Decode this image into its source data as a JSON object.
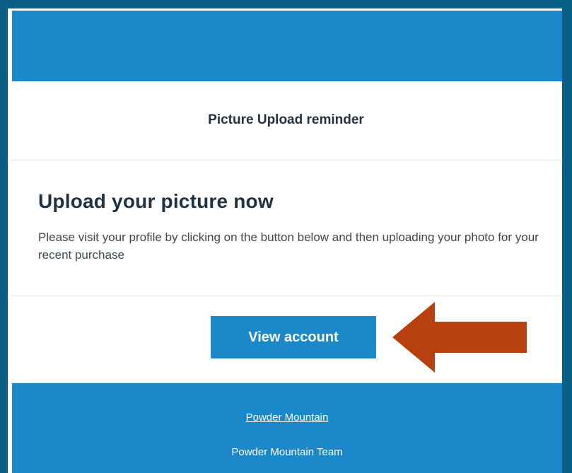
{
  "email": {
    "subject": "Picture Upload reminder",
    "heading": "Upload your picture now",
    "body": "Please visit your profile by clicking on the button below and then uploading your photo for your recent purchase",
    "cta_label": "View account",
    "footer": {
      "link": "Powder Mountain",
      "signature": "Powder Mountain Team"
    }
  },
  "colors": {
    "background": "#0a5f87",
    "brand_blue": "#1a88c9",
    "heading_text": "#1f3242",
    "arrow": "#b8400f"
  },
  "icons": {
    "annotation_arrow": "left-pointing-arrow-icon"
  }
}
